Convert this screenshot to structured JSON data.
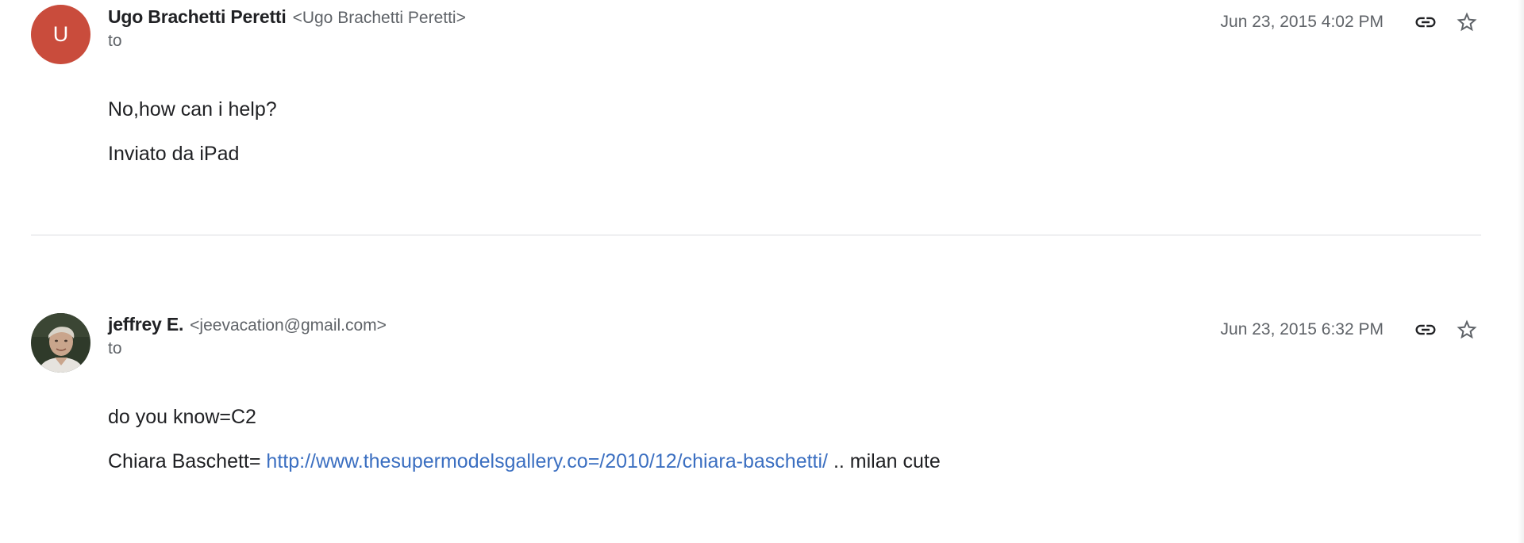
{
  "messages": [
    {
      "avatar_letter": "U",
      "avatar_color": "#c94c3c",
      "sender_name": "Ugo Brachetti Peretti",
      "sender_email": "<Ugo Brachetti Peretti>",
      "to_label": "to",
      "timestamp": "Jun 23, 2015 4:02 PM",
      "body": [
        {
          "text": "No,how can i help?"
        },
        {
          "text": "Inviato da iPad"
        }
      ],
      "link_icon": "link-icon",
      "star_icon": "star-outline-icon"
    },
    {
      "avatar_image": "photo-avatar",
      "sender_name": "jeffrey E.",
      "sender_email": "<jeevacation@gmail.com>",
      "to_label": "to",
      "timestamp": "Jun 23, 2015 6:32 PM",
      "body": [
        {
          "text": "do you know=C2"
        },
        {
          "prefix": "Chiara Baschett= ",
          "link": "http://www.thesupermodelsgallery.co=/2010/12/chiara-baschetti/",
          "suffix": " .. milan cute"
        }
      ],
      "link_icon": "link-icon",
      "star_icon": "star-outline-icon"
    }
  ],
  "colors": {
    "link": "#3b6fc1",
    "meta_text": "#5f6368",
    "primary_text": "#202124",
    "divider": "#dadce0"
  }
}
